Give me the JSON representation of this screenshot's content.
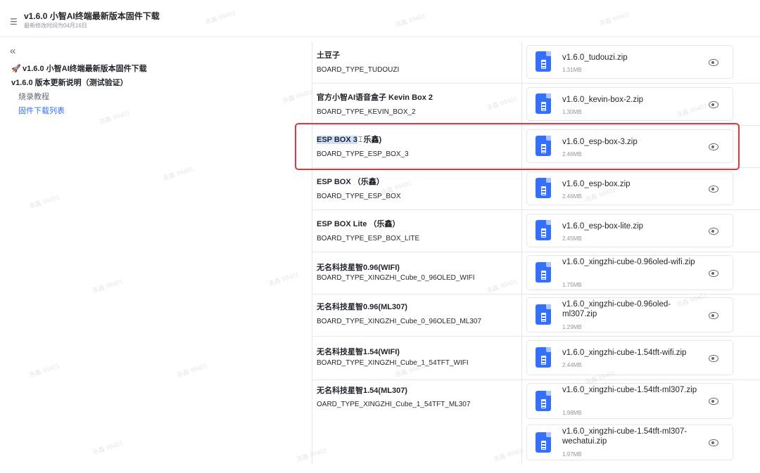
{
  "header": {
    "title": "v1.6.0 小智AI终端最新版本固件下载",
    "subtitle": "最新修改时间为04月16日"
  },
  "sidebar": {
    "items": [
      {
        "label": "v1.6.0 小智AI终端最新版本固件下载",
        "level": 1
      },
      {
        "label": "v1.6.0 版本更新说明（测试验证）",
        "level": 2
      },
      {
        "label": "烧录教程",
        "level": 3
      },
      {
        "label": "固件下载列表",
        "level": 3,
        "active": true
      }
    ]
  },
  "watermark": "洛鑫 99401",
  "rows": [
    {
      "name": "土豆子",
      "type": "BOARD_TYPE_TUDOUZI",
      "files": [
        {
          "name": "v1.6.0_tudouzi.zip",
          "size": "1.31MB"
        }
      ]
    },
    {
      "name": "官方小智AI语音盒子 Kevin Box 2",
      "type": "BOARD_TYPE_KEVIN_BOX_2",
      "files": [
        {
          "name": "v1.6.0_kevin-box-2.zip",
          "size": "1.30MB"
        }
      ]
    },
    {
      "name_highlight": "ESP BOX 3",
      "name_rest": "乐鑫)",
      "type": "BOARD_TYPE_ESP_BOX_3",
      "files": [
        {
          "name": "v1.6.0_esp-box-3.zip",
          "size": "2.46MB"
        }
      ]
    },
    {
      "name": "ESP BOX （乐鑫）",
      "type": "BOARD_TYPE_ESP_BOX",
      "files": [
        {
          "name": "v1.6.0_esp-box.zip",
          "size": "2.46MB"
        }
      ]
    },
    {
      "name": "ESP BOX Lite （乐鑫）",
      "type": "BOARD_TYPE_ESP_BOX_LITE",
      "files": [
        {
          "name": "v1.6.0_esp-box-lite.zip",
          "size": "2.45MB"
        }
      ]
    },
    {
      "name": "无名科技星智0.96(WIFI)",
      "type": "BOARD_TYPE_XINGZHI_Cube_0_96OLED_WIFI",
      "files": [
        {
          "name": "v1.6.0_xingzhi-cube-0.96oled-wifi.zip",
          "size": "1.75MB"
        }
      ]
    },
    {
      "name": "无名科技星智0.96(ML307)",
      "type": "BOARD_TYPE_XINGZHI_Cube_0_96OLED_ML307",
      "files": [
        {
          "name": "v1.6.0_xingzhi-cube-0.96oled-ml307.zip",
          "size": "1.29MB"
        }
      ]
    },
    {
      "name": "无名科技星智1.54(WIFI)",
      "type": "BOARD_TYPE_XINGZHI_Cube_1_54TFT_WIFI",
      "files": [
        {
          "name": "v1.6.0_xingzhi-cube-1.54tft-wifi.zip",
          "size": "2.44MB"
        }
      ]
    },
    {
      "name": "无名科技星智1.54(ML307)",
      "type": "OARD_TYPE_XINGZHI_Cube_1_54TFT_ML307",
      "files": [
        {
          "name": "v1.6.0_xingzhi-cube-1.54tft-ml307.zip",
          "size": "1.98MB"
        },
        {
          "name": "v1.6.0_xingzhi-cube-1.54tft-ml307-wechatui.zip",
          "size": "1.97MB"
        }
      ]
    }
  ],
  "colors": {
    "accent": "#3370ff",
    "annotation": "#e8333d",
    "highlight": "#cfe0fb"
  }
}
